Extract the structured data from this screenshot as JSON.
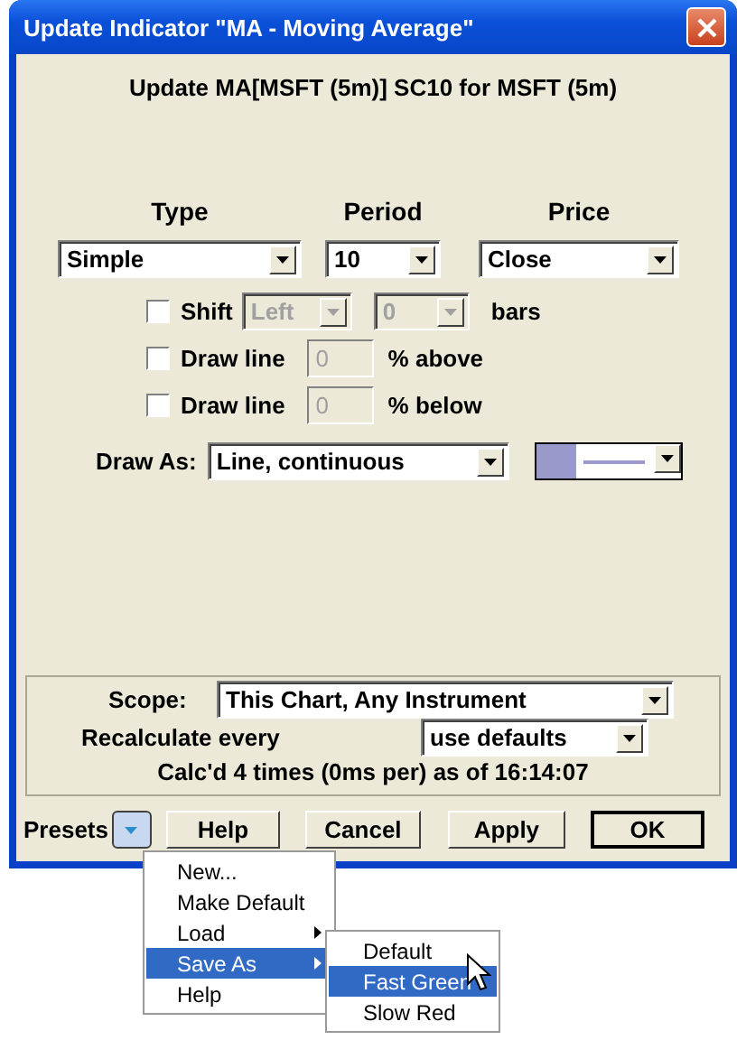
{
  "window": {
    "title": "Update Indicator \"MA - Moving Average\""
  },
  "heading": "Update MA[MSFT (5m)] SC10 for MSFT (5m)",
  "columns": [
    {
      "label": "Type",
      "value": "Simple"
    },
    {
      "label": "Period",
      "value": "10"
    },
    {
      "label": "Price",
      "value": "Close"
    }
  ],
  "shift": {
    "label": "Shift",
    "checked": false,
    "direction": "Left",
    "amount": "0",
    "unit": "bars",
    "disabled": true
  },
  "draw_lines": [
    {
      "label": "Draw line",
      "checked": false,
      "value": "0",
      "suffix": "% above",
      "disabled": true
    },
    {
      "label": "Draw line",
      "checked": false,
      "value": "0",
      "suffix": "% below",
      "disabled": true
    }
  ],
  "draw_as": {
    "label": "Draw As:",
    "value": "Line, continuous",
    "color": "#9999cc"
  },
  "scope": {
    "label": "Scope:",
    "value": "This Chart, Any Instrument"
  },
  "recalculate": {
    "label": "Recalculate every",
    "value": "use defaults"
  },
  "status": "Calc'd 4 times (0ms per) as of 16:14:07",
  "presets_label": "Presets",
  "buttons": [
    {
      "label": "Help",
      "default": false
    },
    {
      "label": "Cancel",
      "default": false
    },
    {
      "label": "Apply",
      "default": false
    },
    {
      "label": "OK",
      "default": true
    }
  ],
  "presets_menu": [
    {
      "label": "New...",
      "submenu": false,
      "selected": false
    },
    {
      "label": "Make Default",
      "submenu": false,
      "selected": false
    },
    {
      "label": "Load",
      "submenu": true,
      "selected": false
    },
    {
      "label": "Save As",
      "submenu": true,
      "selected": true
    },
    {
      "label": "Help",
      "submenu": false,
      "selected": false
    }
  ],
  "save_as_menu": [
    {
      "label": "Default",
      "selected": false
    },
    {
      "label": "Fast Green",
      "selected": true
    },
    {
      "label": "Slow Red",
      "selected": false
    }
  ]
}
